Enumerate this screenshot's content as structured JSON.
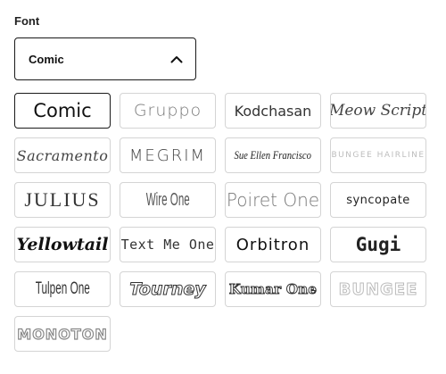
{
  "font_picker": {
    "label": "Font",
    "selected_value": "Comic",
    "options": [
      {
        "label": "Comic",
        "slug": "comic"
      },
      {
        "label": "Gruppo",
        "slug": "gruppo"
      },
      {
        "label": "Kodchasan",
        "slug": "kodchasan"
      },
      {
        "label": "Meow Script",
        "slug": "meow"
      },
      {
        "label": "Sacramento",
        "slug": "sacramento"
      },
      {
        "label": "MEGRIM",
        "slug": "megrim"
      },
      {
        "label": "Sue Ellen Francisco",
        "slug": "sueellen"
      },
      {
        "label": "BUNGEE HAIRLINE",
        "slug": "bungeehair"
      },
      {
        "label": "JULIUS",
        "slug": "julius"
      },
      {
        "label": "Wire One",
        "slug": "wireone"
      },
      {
        "label": "Poiret One",
        "slug": "poiret"
      },
      {
        "label": "syncopate",
        "slug": "syncopate"
      },
      {
        "label": "Yellowtail",
        "slug": "yellowtail"
      },
      {
        "label": "Text Me One",
        "slug": "textmeone"
      },
      {
        "label": "Orbitron",
        "slug": "orbitron"
      },
      {
        "label": "Gugi",
        "slug": "gugi"
      },
      {
        "label": "Tulpen One",
        "slug": "tulpen"
      },
      {
        "label": "Tourney",
        "slug": "tourney"
      },
      {
        "label": "Kumar One",
        "slug": "kumarone"
      },
      {
        "label": "BUNGEE",
        "slug": "bungeeshade"
      },
      {
        "label": "MONOTON",
        "slug": "monoton"
      }
    ]
  },
  "icons": {
    "dropdown_toggle": "chevron-up-icon"
  },
  "colors": {
    "selected_border": "#1a1a1a",
    "tile_border": "#d4d4d4"
  }
}
